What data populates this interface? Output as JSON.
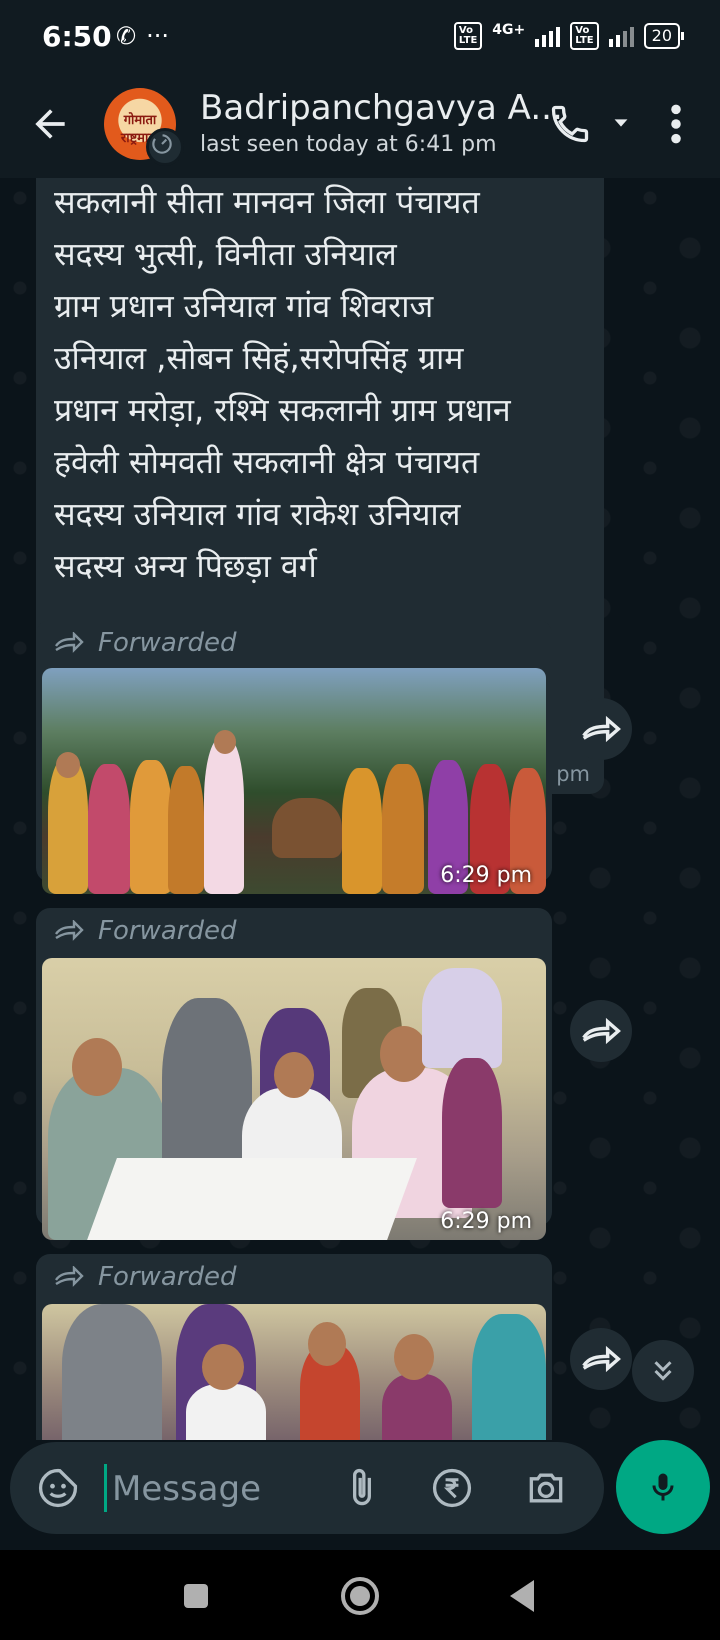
{
  "status_bar": {
    "time": "6:50",
    "icons": [
      "whatsapp-icon",
      "more-notifications-icon"
    ],
    "network": "4G+",
    "battery": "20"
  },
  "header": {
    "chat_name": "Badripanchgavya A...",
    "last_seen": "last seen today at 6:41 pm",
    "avatar_text": "गोमाता राष्ट्रमाता"
  },
  "messages": [
    {
      "type": "text",
      "text": "सकलानी सीता मानवन जिला पंचायत\nसदस्य भुत्सी, विनीता उनियाल\nग्राम प्रधान उनियाल गांव शिवराज\nउनियाल ,सोबन सिहं,सरोपसिंह ग्राम\nप्रधान मरोड़ा, रश्मि सकलानी ग्राम प्रधान\nहवेली सोमवती सकलानी क्षेत्र पंचायत\nसदस्य उनियाल गांव राकेश उनियाल\nसदस्य अन्य पिछड़ा वर्ग",
      "time": "6:29 pm"
    },
    {
      "type": "image",
      "forwarded_label": "Forwarded",
      "time": "6:29 pm"
    },
    {
      "type": "image",
      "forwarded_label": "Forwarded",
      "time": "6:29 pm"
    },
    {
      "type": "image",
      "forwarded_label": "Forwarded",
      "time": ""
    }
  ],
  "input": {
    "placeholder": "Message"
  },
  "colors": {
    "accent": "#00a884",
    "bubble": "#202c33",
    "background": "#0b141a",
    "header": "#111b21"
  }
}
